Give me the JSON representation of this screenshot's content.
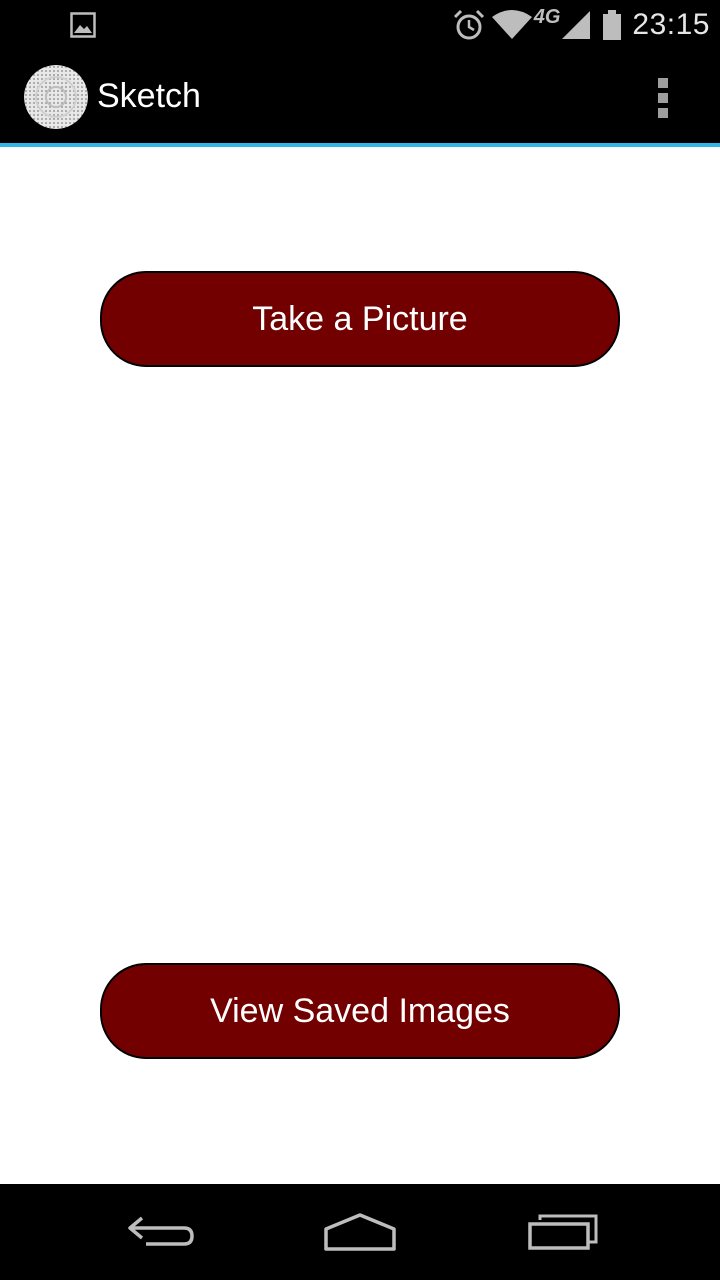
{
  "status_bar": {
    "time": "23:15",
    "network_label": "4G",
    "icons": [
      "image-notification-icon",
      "alarm-icon",
      "wifi-icon",
      "lte-icon",
      "signal-icon",
      "battery-icon"
    ]
  },
  "action_bar": {
    "title": "Sketch",
    "accent_color": "#33b5e5",
    "icons": [
      "app-logo-icon",
      "overflow-menu-icon"
    ]
  },
  "main": {
    "take_picture_label": "Take a Picture",
    "view_saved_label": "View Saved Images",
    "button_color": "#730000"
  },
  "nav_bar": {
    "icons": [
      "back-icon",
      "home-icon",
      "recents-icon"
    ]
  }
}
